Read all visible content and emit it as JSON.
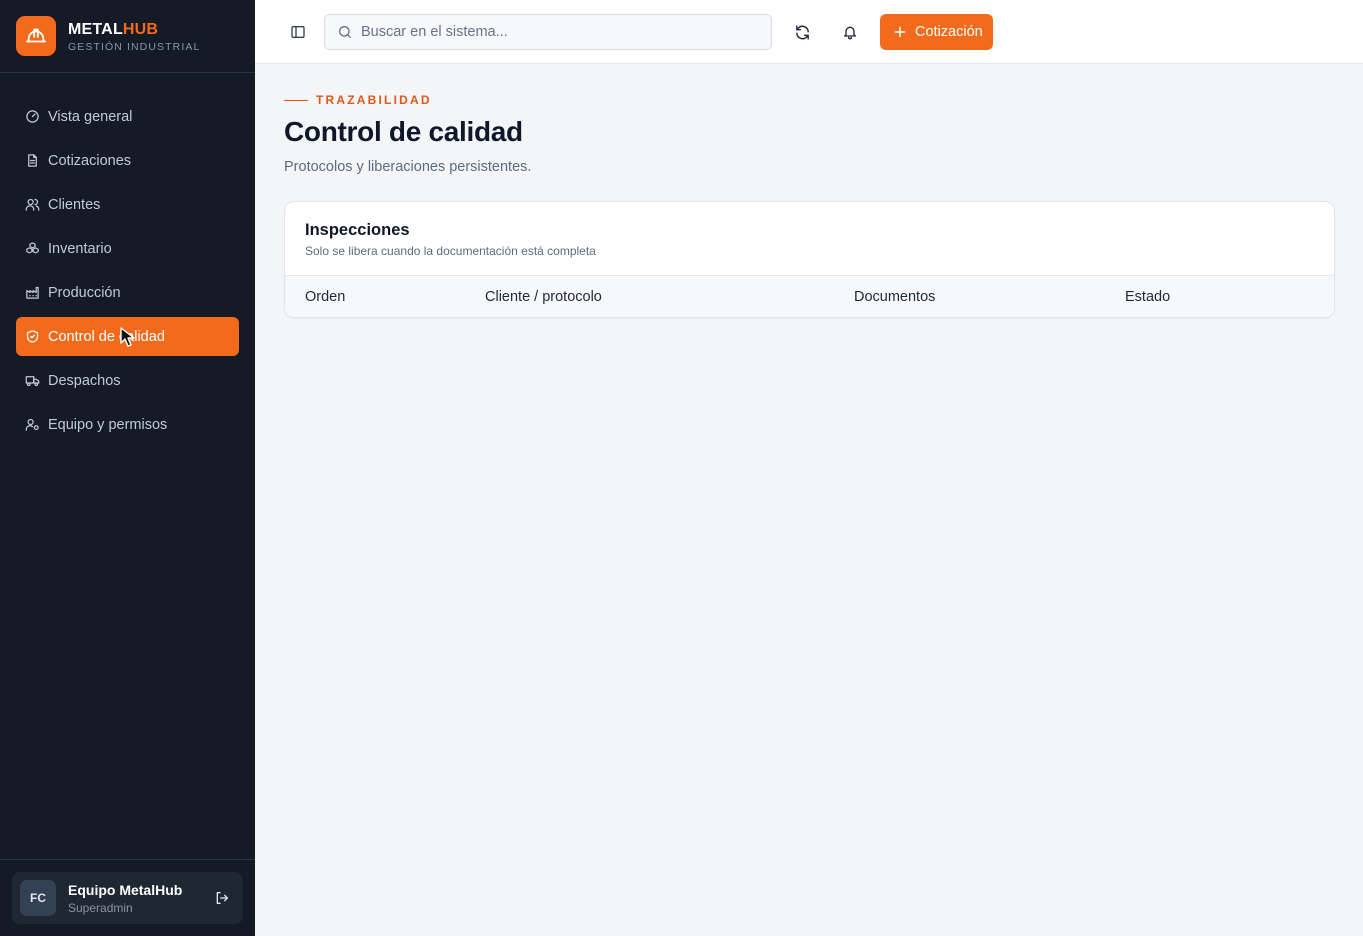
{
  "brand": {
    "name_main": "METAL",
    "name_accent": "HUB",
    "subtitle": "GESTIÓN INDUSTRIAL",
    "logo_icon": "hardhat-icon"
  },
  "sidebar": {
    "items": [
      {
        "label": "Vista general",
        "icon": "gauge-icon",
        "active": false
      },
      {
        "label": "Cotizaciones",
        "icon": "document-icon",
        "active": false
      },
      {
        "label": "Clientes",
        "icon": "users-icon",
        "active": false
      },
      {
        "label": "Inventario",
        "icon": "boxes-icon",
        "active": false
      },
      {
        "label": "Producción",
        "icon": "factory-icon",
        "active": false
      },
      {
        "label": "Control de calidad",
        "icon": "shield-check-icon",
        "active": true
      },
      {
        "label": "Despachos",
        "icon": "truck-icon",
        "active": false
      },
      {
        "label": "Equipo y permisos",
        "icon": "user-cog-icon",
        "active": false
      }
    ]
  },
  "user": {
    "initials": "FC",
    "name": "Equipo MetalHub",
    "role": "Superadmin"
  },
  "topbar": {
    "search_placeholder": "Buscar en el sistema...",
    "cta_label": "Cotización"
  },
  "page": {
    "eyebrow": "TRAZABILIDAD",
    "title": "Control de calidad",
    "subtitle": "Protocolos y liberaciones persistentes."
  },
  "card": {
    "title": "Inspecciones",
    "subtitle": "Solo se libera cuando la documentación está completa",
    "columns": [
      "Orden",
      "Cliente / protocolo",
      "Documentos",
      "Estado"
    ]
  },
  "colors": {
    "accent": "#f26a1b",
    "sidebar_bg": "#141b26"
  }
}
